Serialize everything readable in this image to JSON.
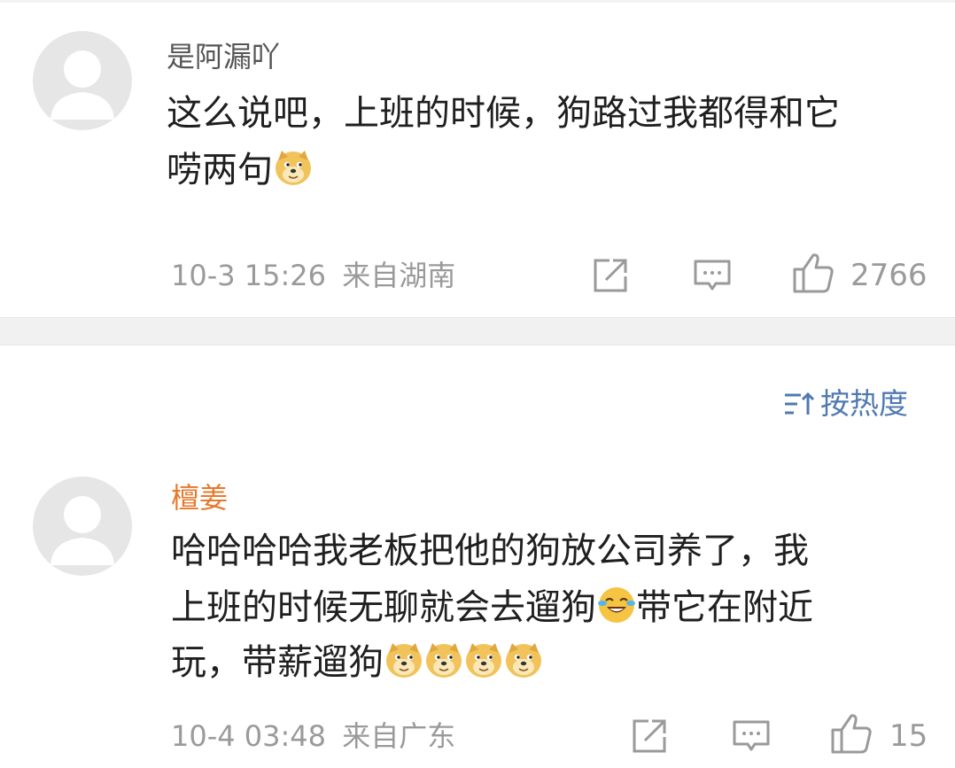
{
  "comments": [
    {
      "username": "是阿漏吖",
      "username_color": "#555555",
      "lines": [
        "这么说吧，上班的时候，狗路过我都得和它",
        "唠两句"
      ],
      "emojis_line2": [
        "doge"
      ],
      "time": "10-3 15:26",
      "location": "来自湖南",
      "likes": "2766"
    },
    {
      "username": "檀姜",
      "username_color": "#e9782b",
      "lines": [
        "哈哈哈哈我老板把他的狗放公司养了，我",
        "上班的时候无聊就会去遛狗",
        "带它在附近",
        "玩，带薪遛狗"
      ],
      "emojis": [
        "laugh-cry",
        "doge",
        "doge",
        "doge",
        "doge"
      ],
      "time": "10-4 03:48",
      "location": "来自广东",
      "likes": "15"
    }
  ],
  "sort": {
    "label": "按热度"
  },
  "icons": [
    "share-icon",
    "comment-icon",
    "like-icon",
    "sort-icon",
    "doge-emoji",
    "laugh-cry-emoji"
  ],
  "colors": {
    "meta": "#9a9a9a",
    "link_blue": "#4f79b2",
    "orange_name": "#e9782b",
    "divider": "#f1f1f1"
  }
}
